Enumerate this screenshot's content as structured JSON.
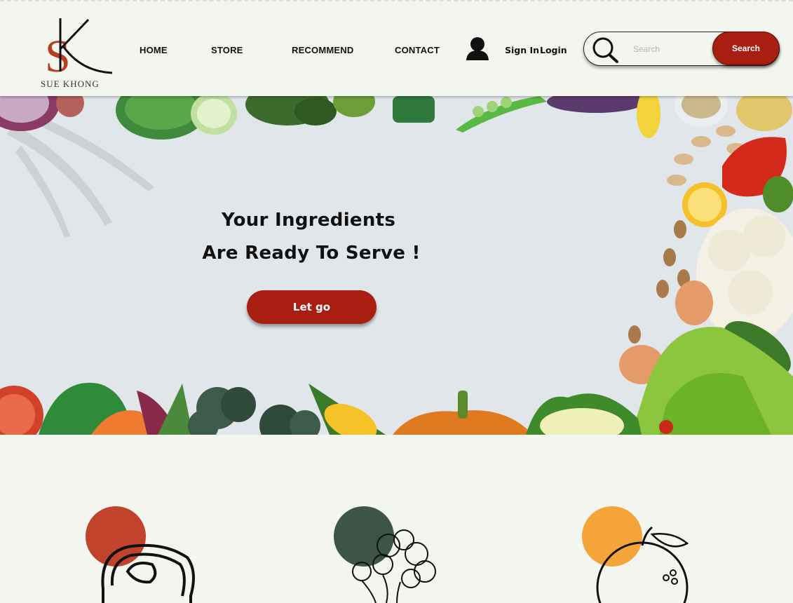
{
  "brand": {
    "name": "SUE KHONG",
    "initials": "SK",
    "accent": "#a81f12"
  },
  "nav": {
    "items": [
      {
        "label": "HOME"
      },
      {
        "label": "STORE"
      },
      {
        "label": "RECOMMEND"
      },
      {
        "label": "CONTACT"
      }
    ]
  },
  "auth": {
    "icon": "user-icon",
    "sign_in": "Sign In",
    "login": "Login"
  },
  "search": {
    "placeholder": "Search",
    "button": "Search",
    "icon": "search-icon"
  },
  "hero": {
    "title_line1": "Your Ingredients",
    "title_line2": "Are Ready To Serve !",
    "cta": "Let go"
  },
  "categories": [
    {
      "icon": "meat-steak-icon",
      "color": "#c1432b"
    },
    {
      "icon": "broccoli-icon",
      "color": "#3c5548"
    },
    {
      "icon": "orange-fruit-icon",
      "color": "#f5a43a"
    }
  ]
}
